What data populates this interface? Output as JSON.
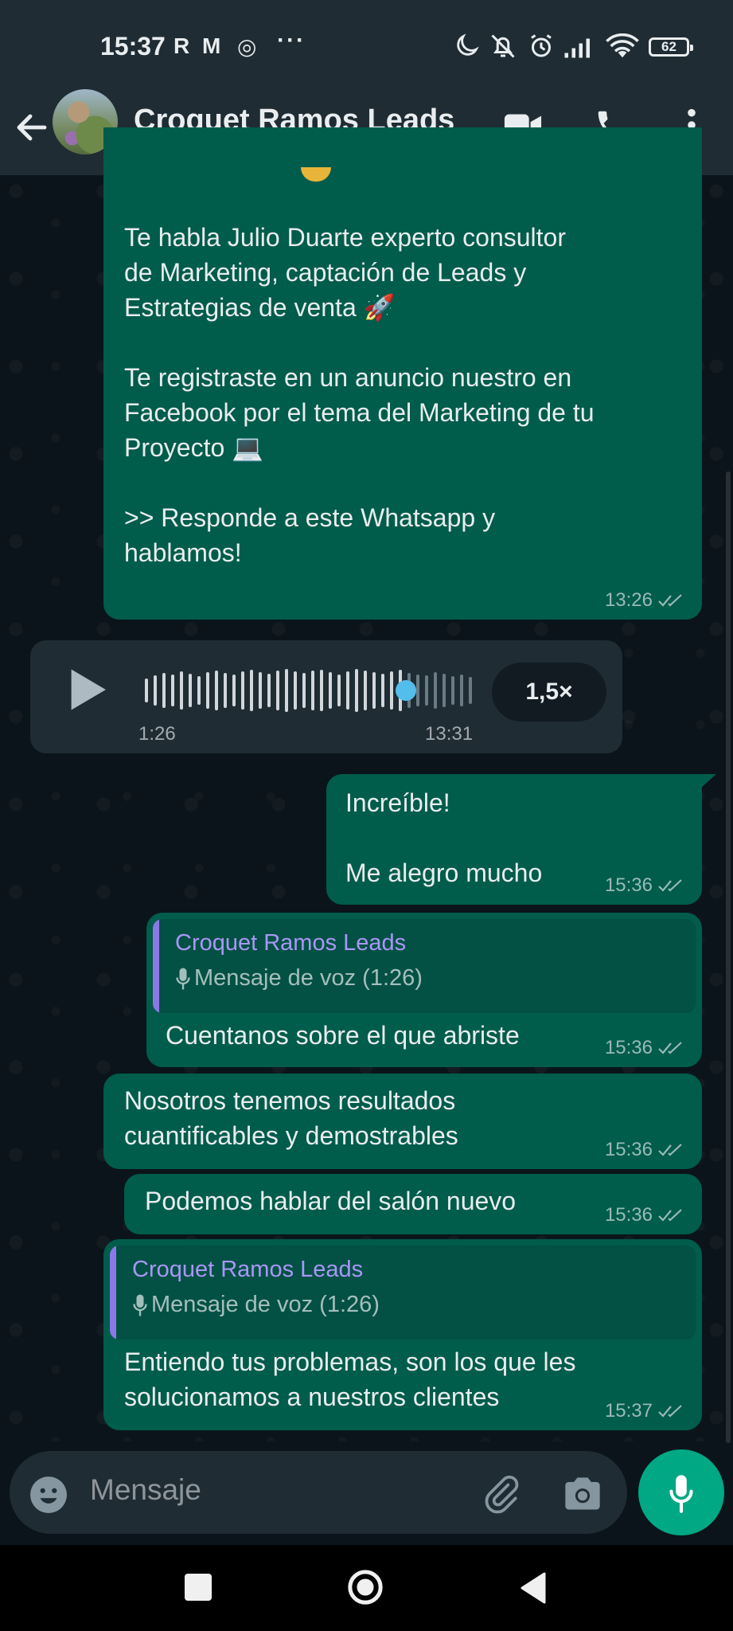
{
  "status_bar": {
    "time": "15:37",
    "app_icons": [
      "R",
      "M",
      "◎"
    ],
    "more": "···",
    "battery": "62"
  },
  "header": {
    "title": "Croquet Ramos Leads"
  },
  "messages": {
    "m1": {
      "text": "Te habla Julio Duarte experto consultor\nde Marketing, captación de Leads y\nEstrategias de venta 🚀\n\nTe registraste en un anuncio nuestro en\nFacebook por el tema del Marketing de tu\nProyecto 💻\n\n>> Responde a este Whatsapp y\nhablamos!",
      "time": "13:26"
    },
    "voice": {
      "duration": "1:26",
      "time": "13:31",
      "speed": "1,5×"
    },
    "m2": {
      "text": "Increíble!\n\nMe alegro mucho",
      "time": "15:36"
    },
    "m3": {
      "quote_name": "Croquet Ramos Leads",
      "quote_text": "Mensaje de voz (1:26)",
      "text": "Cuentanos sobre el que abriste",
      "time": "15:36"
    },
    "m4": {
      "text": "Nosotros tenemos resultados\ncuantificables y demostrables",
      "time": "15:36"
    },
    "m5": {
      "text": "Podemos hablar del salón nuevo",
      "time": "15:36"
    },
    "m6": {
      "quote_name": "Croquet Ramos Leads",
      "quote_text": "Mensaje de voz (1:26)",
      "text": "Entiendo tus problemas, son los que les\nsolucionamos a nuestros clientes",
      "time": "15:37"
    }
  },
  "input": {
    "placeholder": "Mensaje"
  },
  "colors": {
    "outgoing_bubble": "#005c4b",
    "incoming_bubble": "#1f2c33",
    "accent_green": "#00a884",
    "quote_name": "#a897f5"
  }
}
